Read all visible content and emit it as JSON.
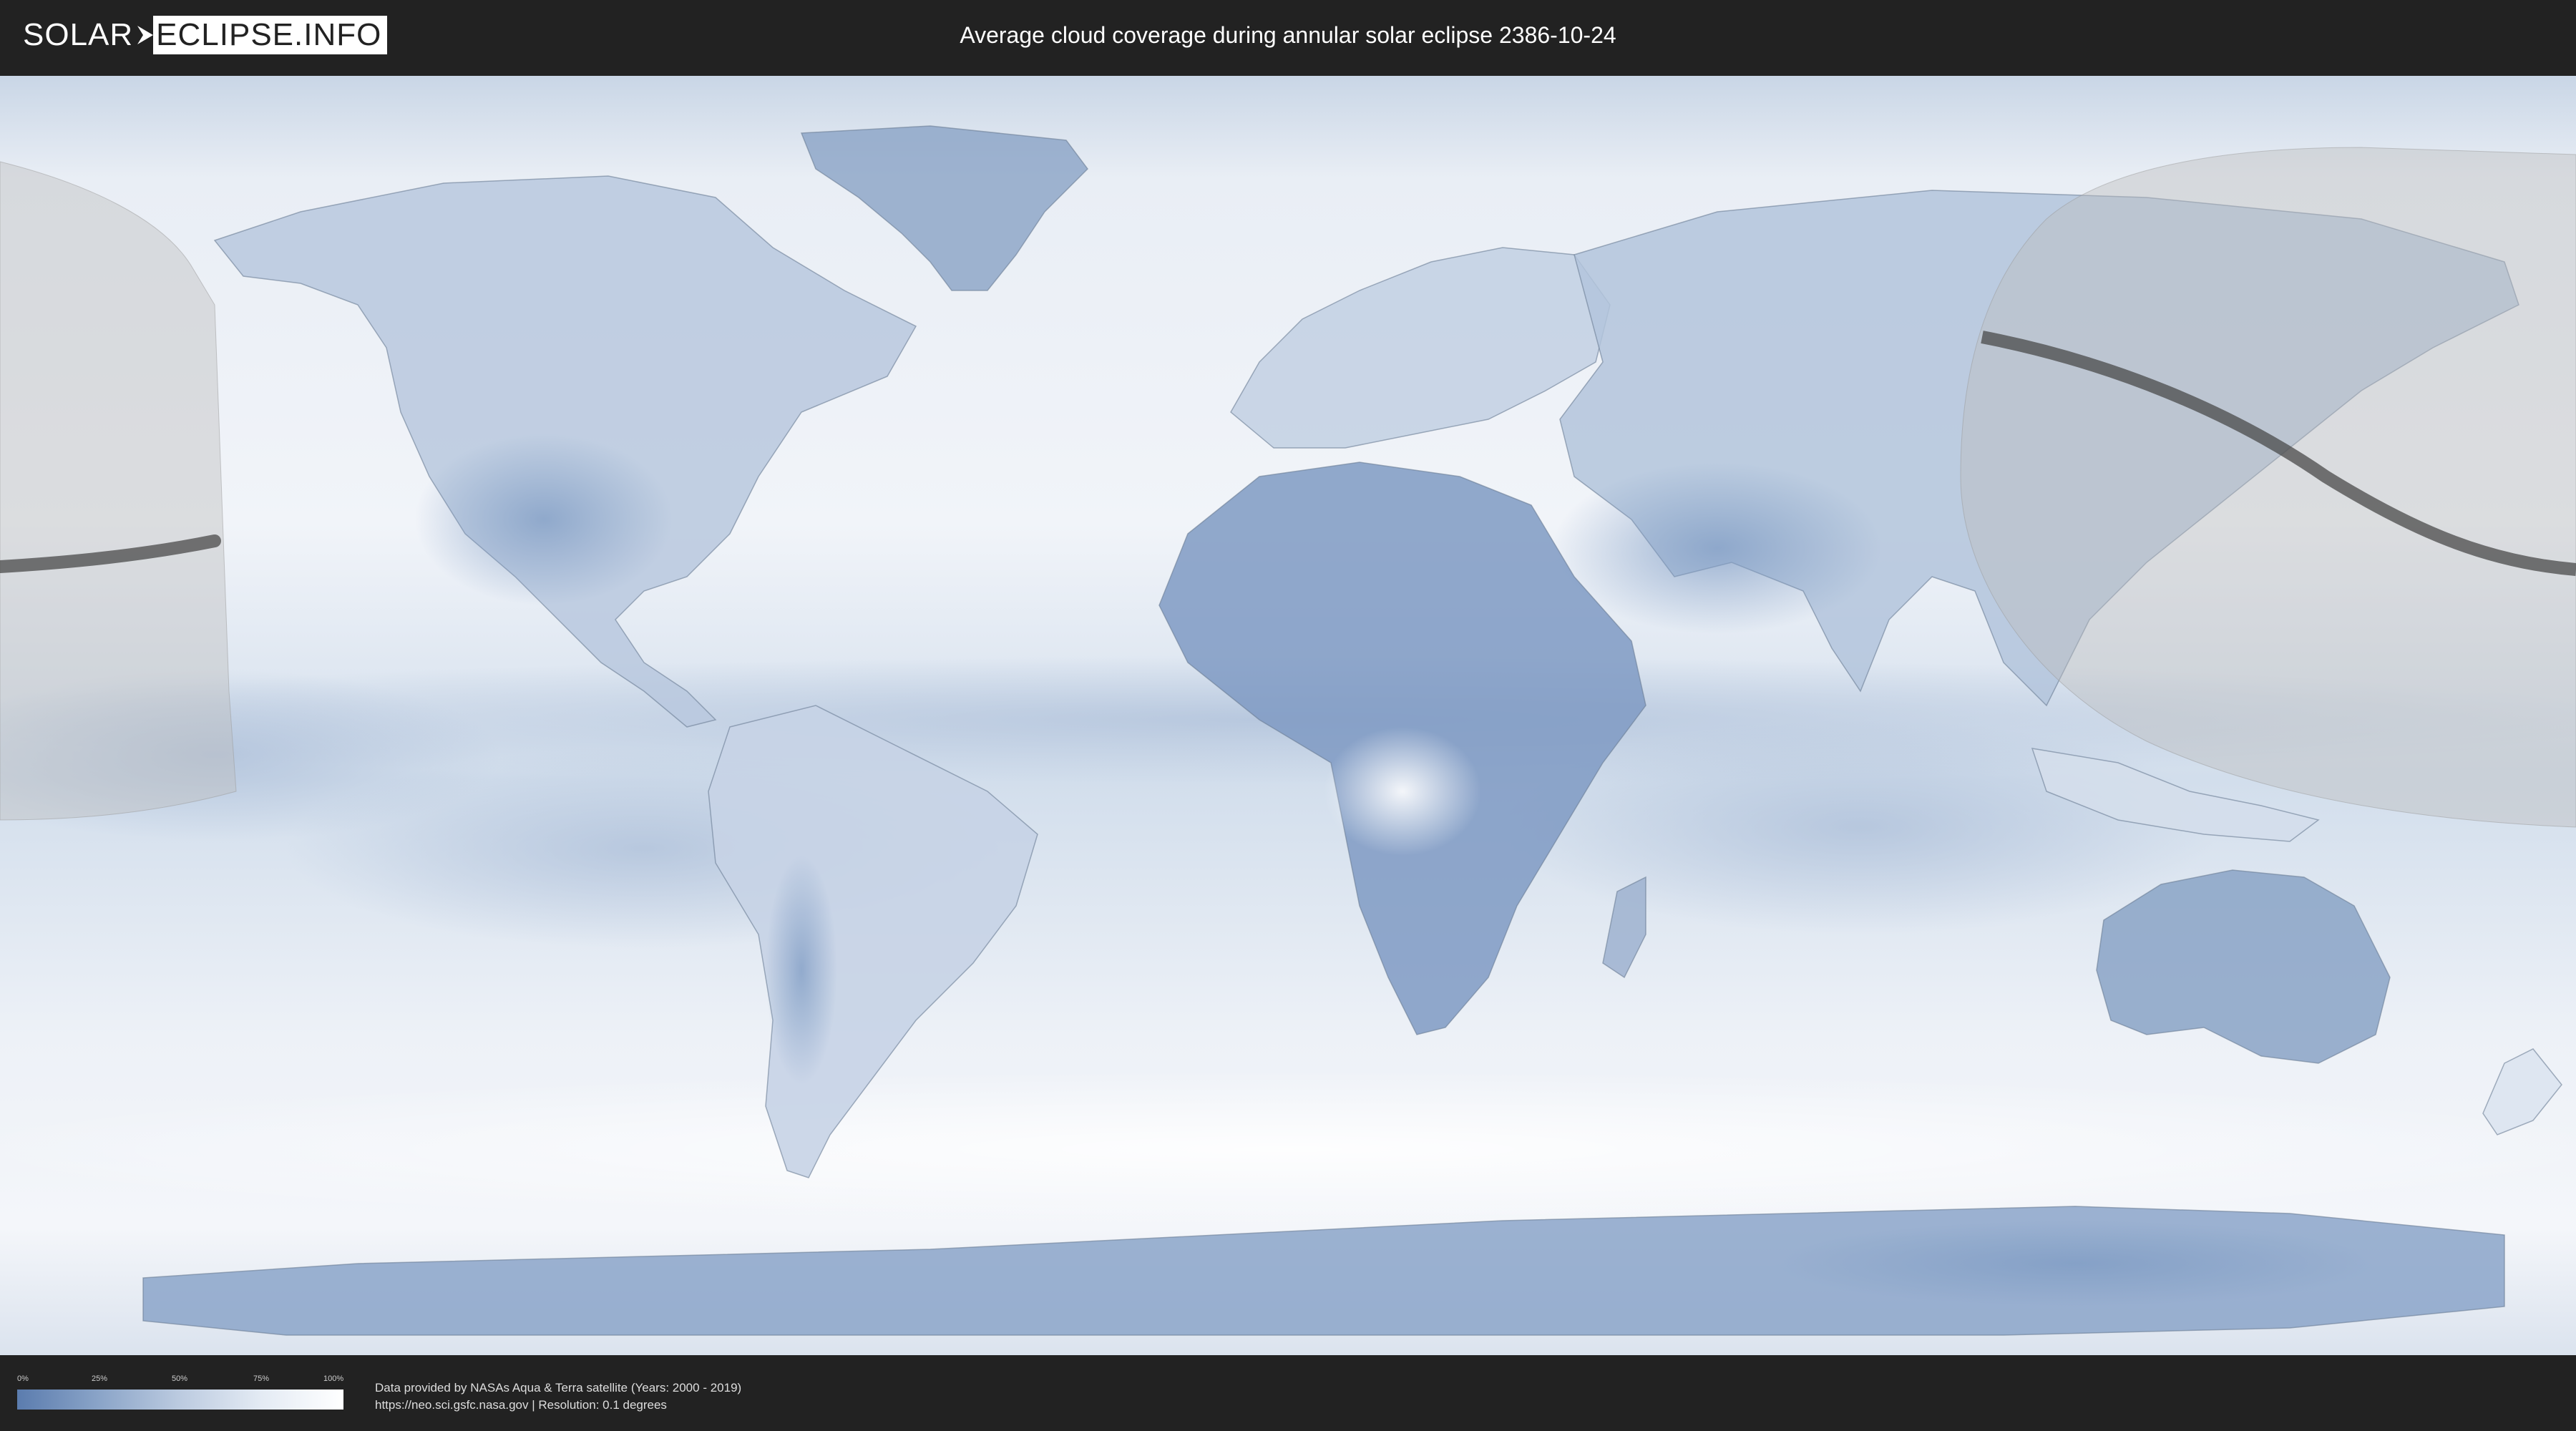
{
  "header": {
    "logo_left": "SOLAR",
    "logo_right": "ECLIPSE.INFO",
    "title": "Average cloud coverage during annular solar eclipse 2386-10-24"
  },
  "legend": {
    "ticks": [
      "0%",
      "25%",
      "50%",
      "75%",
      "100%"
    ],
    "colors": [
      "#5b7cae",
      "#8aa4c8",
      "#bccbe0",
      "#e4ebf4",
      "#ffffff"
    ]
  },
  "credits": {
    "line1": "Data provided by NASAs Aqua & Terra satellite (Years: 2000 - 2019)",
    "line2": "https://neo.sci.gsfc.nasa.gov | Resolution: 0.1 degrees"
  },
  "map": {
    "colors": {
      "clear_sky": "#5b7cae",
      "cloudy": "#ffffff",
      "eclipse_zone": "#bdbdbd",
      "eclipse_path": "#4a4a4a",
      "coastline": "#6a7d95"
    }
  }
}
